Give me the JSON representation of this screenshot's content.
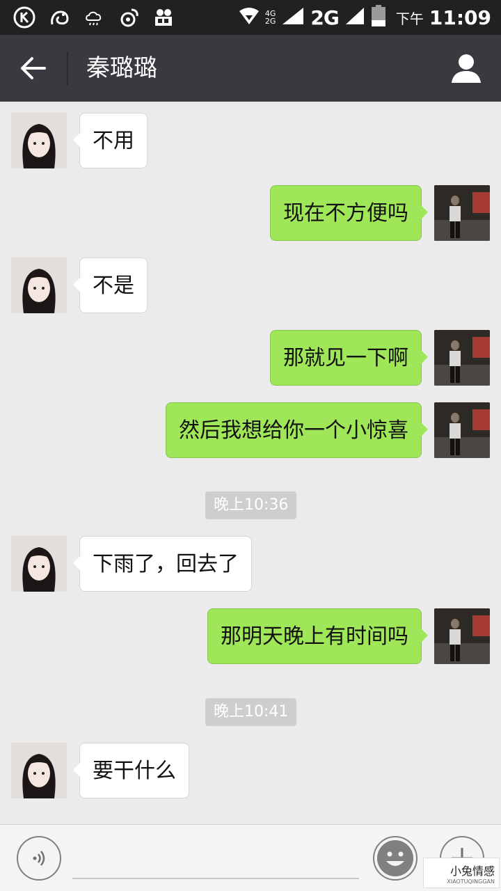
{
  "status_bar": {
    "network_small_top": "4G",
    "network_small_bottom": "2G",
    "network": "2G",
    "time_prefix": "下午",
    "time": "11:09",
    "icons": [
      "k-app-icon",
      "uc-browser-icon",
      "cloud-icon",
      "weibo-icon",
      "video-camera-icon",
      "wifi-icon",
      "signal-icon",
      "battery-icon"
    ]
  },
  "header": {
    "contact_name": "秦璐璐",
    "back_icon": "arrow-left-icon",
    "profile_icon": "person-icon"
  },
  "messages": [
    {
      "sender": "her",
      "text": "不用"
    },
    {
      "sender": "me",
      "text": "现在不方便吗"
    },
    {
      "sender": "her",
      "text": "不是"
    },
    {
      "sender": "me",
      "text": "那就见一下啊"
    },
    {
      "sender": "me",
      "text": "然后我想给你一个小惊喜"
    },
    {
      "type": "time",
      "text": "晚上10:36"
    },
    {
      "sender": "her",
      "text": "下雨了，回去了"
    },
    {
      "sender": "me",
      "text": "那明天晚上有时间吗"
    },
    {
      "type": "time",
      "text": "晚上10:41"
    },
    {
      "sender": "her",
      "text": "要干什么"
    }
  ],
  "input_bar": {
    "voice_icon": "voice-icon",
    "emoji_icon": "smiley-icon",
    "plus_icon": "plus-icon"
  },
  "watermark": {
    "main": "小兔情感",
    "sub": "XIAOTUQINGGAN"
  },
  "colors": {
    "status_bar": "#212121",
    "title_bar": "#393a3f",
    "background": "#ebebeb",
    "outgoing_bubble": "#9fe658",
    "incoming_bubble": "#ffffff"
  }
}
